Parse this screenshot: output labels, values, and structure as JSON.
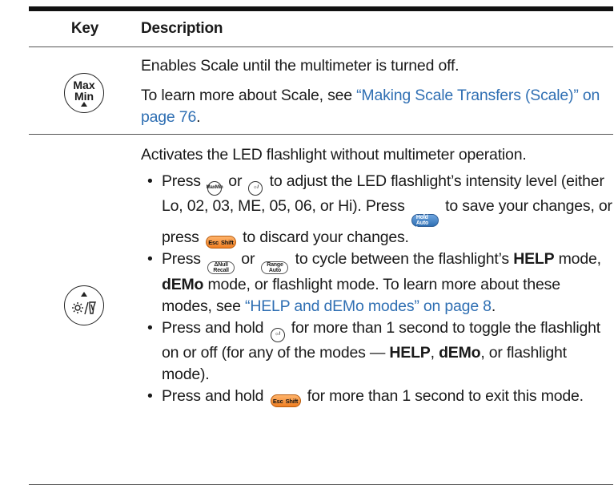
{
  "header": {
    "key": "Key",
    "description": "Description"
  },
  "row1": {
    "key_top": "Max",
    "key_bottom": "Min",
    "p1": "Enables Scale until the multimeter is turned off.",
    "p2_pre": "To learn more about Scale, see ",
    "p2_link": "“Making Scale Transfers (Scale)” on page 76",
    "p2_post": "."
  },
  "row2": {
    "intro": "Activates the LED flashlight without multimeter operation.",
    "b1_1": "Press ",
    "b1_2": " or ",
    "b1_3": " to adjust the LED flashlight’s intensity level (either Lo, 02, 03, ME, 05, 06, or Hi). Press ",
    "b1_4": " to save your changes, or press ",
    "b1_5": " to discard your changes.",
    "b2_1": "Press ",
    "b2_2": " or ",
    "b2_3": " to cycle between the flashlight’s ",
    "b2_help": "HELP",
    "b2_4": " mode, ",
    "b2_demo": "dEMo",
    "b2_5": " mode, or flashlight mode. To learn more about these modes, see ",
    "b2_link": "“HELP and dEMo modes” on page 8",
    "b2_6": ".",
    "b3_1": "Press and hold ",
    "b3_2": " for more than 1 second to toggle the flashlight on or off (for any of the modes — ",
    "b3_help": "HELP",
    "b3_3": ", ",
    "b3_demo": "dEMo",
    "b3_4": ", or flashlight mode).",
    "b4_1": "Press and hold ",
    "b4_2": " for more than 1 second to exit this mode."
  },
  "keys": {
    "maxmin_top": "Max",
    "maxmin_bot": "Min",
    "trig_top": "Trig",
    "trig_mid": "Hold",
    "trig_bot": "Auto",
    "trig_log": "Log",
    "esc": "Esc",
    "shift": "Shift",
    "null_top": "ΔNull",
    "null_bot": "Recall",
    "range_top": "Range",
    "range_bot": "Auto"
  },
  "colors": {
    "link": "#2f6fb3",
    "blue_key": "#2f6fb3",
    "orange_key": "#f07f22"
  }
}
